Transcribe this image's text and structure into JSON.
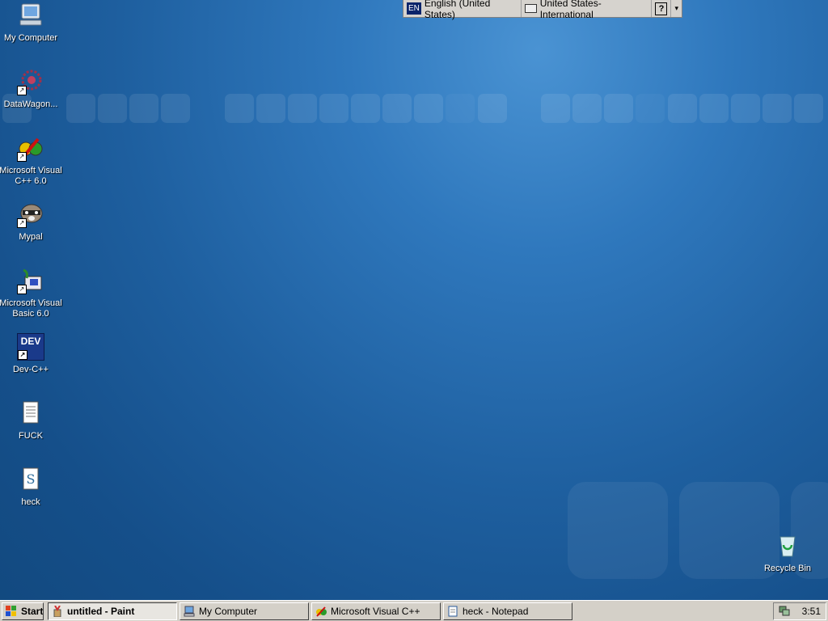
{
  "language_bar": {
    "badge": "EN",
    "language": "English (United States)",
    "keyboard": "United States-International",
    "help": "?",
    "menu_arrow": "▾"
  },
  "desktop": {
    "icons": [
      {
        "label": "My Computer",
        "icon": "computer-icon"
      },
      {
        "label": "DataWagon...",
        "icon": "datawagon-icon"
      },
      {
        "label": "Microsoft Visual C++ 6.0",
        "icon": "visual-cpp-icon"
      },
      {
        "label": "Mypal",
        "icon": "mypal-raccoon-icon"
      },
      {
        "label": "Microsoft Visual Basic 6.0",
        "icon": "visual-basic-icon"
      },
      {
        "label": "Dev-C++",
        "icon": "dev-cpp-icon"
      },
      {
        "label": "FUCK",
        "icon": "text-document-icon"
      },
      {
        "label": "heck",
        "icon": "script-document-icon"
      },
      {
        "label": "Recycle Bin",
        "icon": "recycle-bin-icon"
      }
    ],
    "devcpp_icon_text": "DEV"
  },
  "taskbar": {
    "start_label": "Start",
    "buttons": [
      {
        "label": "untitled - Paint",
        "icon": "paint-icon",
        "active": true
      },
      {
        "label": "My Computer",
        "icon": "computer-icon",
        "active": false
      },
      {
        "label": "Microsoft Visual C++",
        "icon": "visual-cpp-icon",
        "active": false
      },
      {
        "label": "heck - Notepad",
        "icon": "notepad-icon",
        "active": false
      }
    ],
    "clock": "3:51"
  },
  "colors": {
    "desktop": "#1e5f9f",
    "taskbar": "#d4d0c8",
    "selection": "#0a246a"
  }
}
